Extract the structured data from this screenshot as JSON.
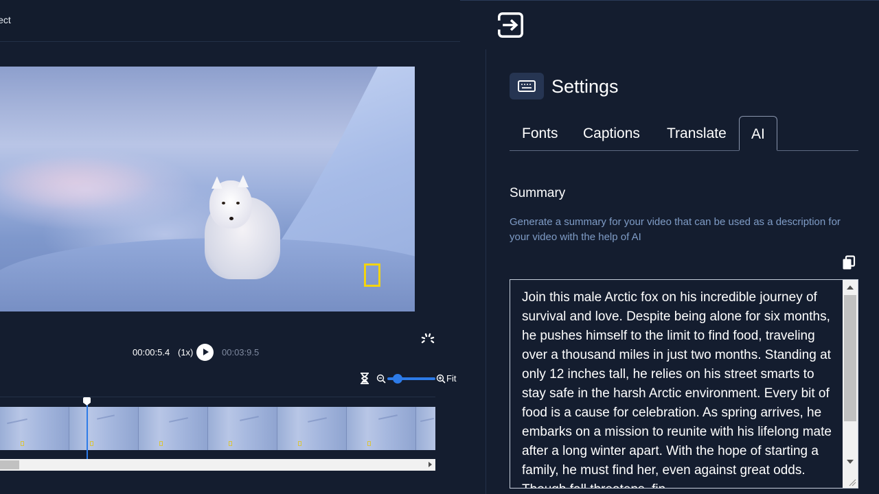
{
  "header": {
    "project_label": "ject"
  },
  "player": {
    "current_time": "00:00:5.4",
    "speed": "(1x)",
    "total_time": "00:03:9.5",
    "zoom_fit_label": "Fit"
  },
  "panel": {
    "title": "Settings",
    "tabs": [
      {
        "label": "Fonts"
      },
      {
        "label": "Captions"
      },
      {
        "label": "Translate"
      },
      {
        "label": "AI",
        "active": true
      }
    ],
    "summary": {
      "title": "Summary",
      "description": "Generate a summary for your video that can be used as a description for your video with the help of AI",
      "text": "Join this male Arctic fox on his incredible journey of survival and love. Despite being alone for six months, he pushes himself to the limit to find food, traveling over a thousand miles in just two months. Standing at only 12 inches tall, he relies on his street smarts to stay safe in the harsh Arctic environment. Every bit of food is a cause for celebration. As spring arrives, he embarks on a mission to reunite with his lifelong mate after a long winter apart. With the hope of starting a family, he must find her, even against great odds. Though fall threatens, fin"
    }
  },
  "icons": {
    "exit": "exit-panel-icon",
    "settings": "keyboard-icon",
    "copy": "copy-icon",
    "spinner": "loading-spinner-icon",
    "hourglass": "hourglass-icon",
    "zoom_out": "zoom-out-icon",
    "zoom_in": "zoom-in-icon"
  },
  "colors": {
    "background": "#141d2f",
    "accent": "#2d7be8",
    "muted_text": "#7f9cc6",
    "natgeo_yellow": "#f3d40f"
  }
}
